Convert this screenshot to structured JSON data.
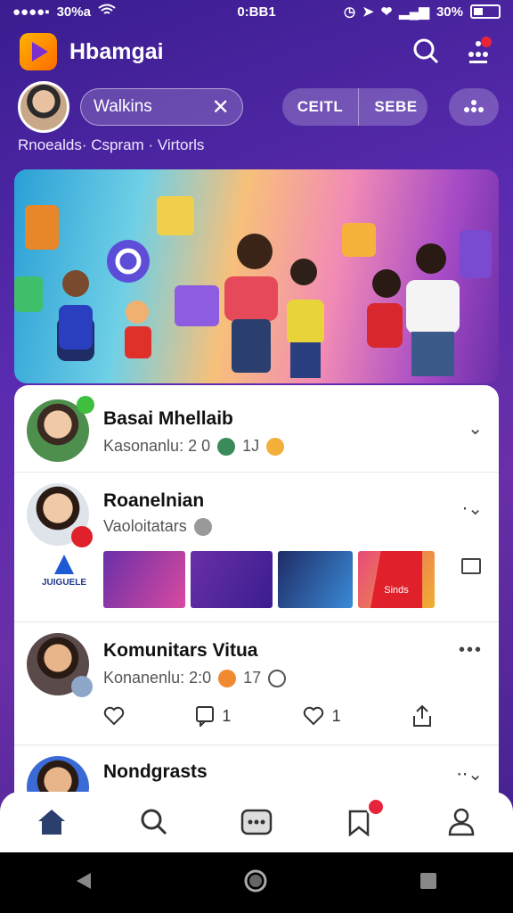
{
  "status": {
    "carrier": "30%a",
    "time": "0:BB1",
    "battery": "30%"
  },
  "header": {
    "title": "Hbamgai"
  },
  "user": {
    "search_value": "Walkins",
    "seg_a": "CEITL",
    "seg_b": "SEBE",
    "breadcrumb": "Rnoealds· Cspram · Virtorls"
  },
  "feed": [
    {
      "name": "Basai Mhellaib",
      "meta": "Kasonanlu: 2 0",
      "meta2": "1J"
    },
    {
      "name": "Roanelnian",
      "meta": "Vaoloitatars"
    },
    {
      "name": "Komunitars Vitua",
      "meta": "Konanenlu: 2:0",
      "meta2": "17",
      "comments": "1",
      "likes": "1"
    },
    {
      "name": "Nondgrasts"
    }
  ],
  "promo": {
    "brand": "JUIGUELE",
    "card": "Sinds"
  }
}
